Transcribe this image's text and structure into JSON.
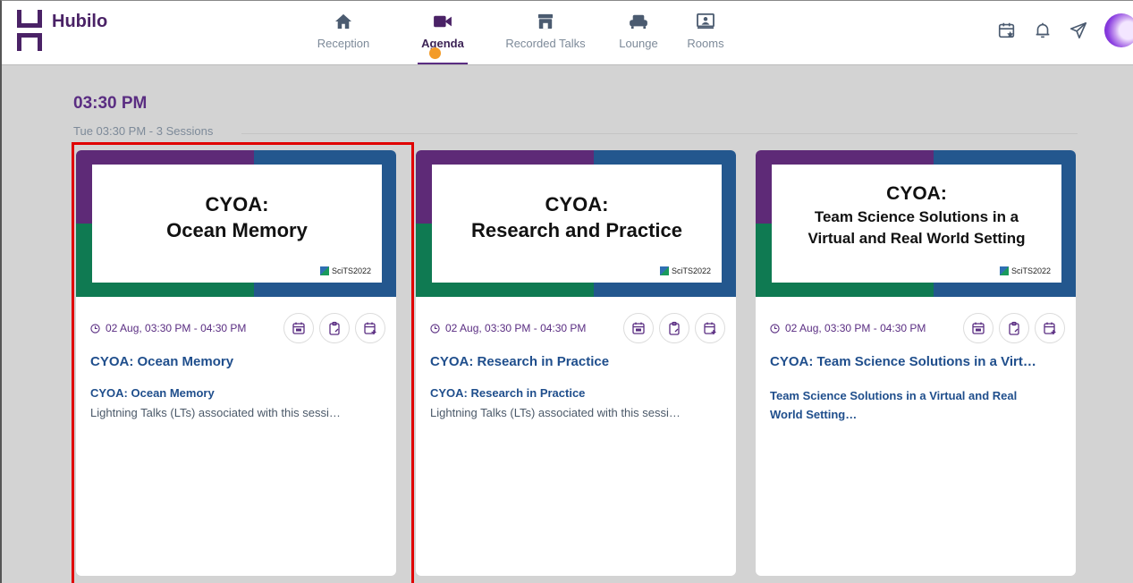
{
  "app": {
    "name": "Hubilo"
  },
  "nav": {
    "items": [
      {
        "label": "Reception",
        "icon": "home-icon"
      },
      {
        "label": "Agenda",
        "icon": "video-icon",
        "active": true
      },
      {
        "label": "Recorded Talks",
        "icon": "store-icon"
      },
      {
        "label": "Lounge",
        "icon": "sofa-icon"
      },
      {
        "label": "Rooms",
        "icon": "rooms-icon"
      }
    ]
  },
  "header_icons": [
    "calendar-star-icon",
    "bell-icon",
    "send-icon",
    "avatar"
  ],
  "agenda": {
    "time_heading": "03:30 PM",
    "sub_heading": "Tue 03:30 PM - 3  Sessions",
    "cards": [
      {
        "banner_line1": "CYOA:",
        "banner_line2": "Ocean Memory",
        "banner_logo": "SciTS2022",
        "time": "02 Aug, 03:30 PM - 04:30 PM",
        "title": "CYOA: Ocean Memory",
        "subtitle": "CYOA: Ocean Memory",
        "description": "Lightning Talks (LTs) associated with this sessi…"
      },
      {
        "banner_line1": "CYOA:",
        "banner_line2": "Research and Practice",
        "banner_logo": "SciTS2022",
        "time": "02 Aug, 03:30 PM - 04:30 PM",
        "title": "CYOA: Research in Practice",
        "subtitle": "CYOA: Research in Practice",
        "description": "Lightning Talks (LTs) associated with this sessi…"
      },
      {
        "banner_line1": "CYOA:",
        "banner_line2": "Team Science Solutions in a",
        "banner_line3": "Virtual and Real World Setting",
        "banner_logo": "SciTS2022",
        "time": "02 Aug, 03:30 PM - 04:30 PM",
        "title": "CYOA: Team Science Solutions in a Virt…",
        "subtitle": "Team Science Solutions in a Virtual and Real World Setting…"
      }
    ]
  },
  "colors": {
    "brand_purple": "#5a2d82",
    "link_blue": "#1f4e8c",
    "banner_purple": "#5e2a77",
    "banner_blue": "#23578e",
    "banner_green": "#0f7a52",
    "highlight_red": "#e00000",
    "notification_dot": "#f39b28"
  }
}
